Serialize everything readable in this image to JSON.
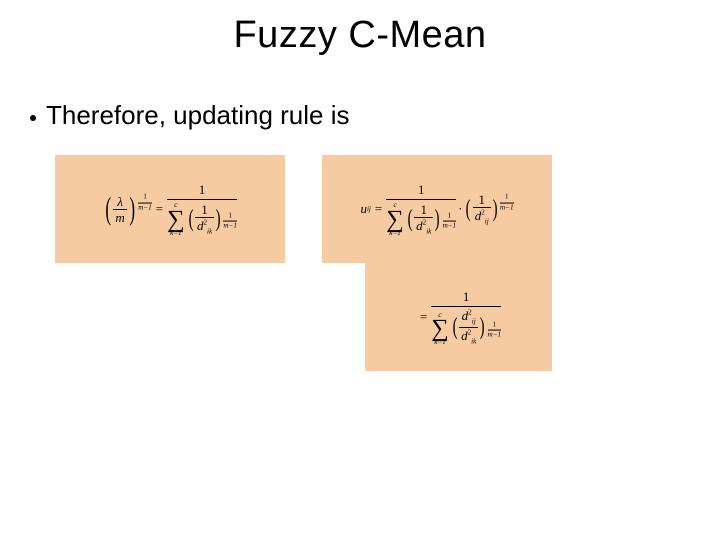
{
  "title": "Fuzzy C-Mean",
  "bullet_text": "Therefore, updating rule is",
  "formulas": {
    "lhs1_lambda": "λ",
    "lhs1_m": "m",
    "exp_num": "1",
    "exp_den_m_minus_1": "m−1",
    "one": "1",
    "sum_upper_c": "c",
    "sum_lower_k": "k=1",
    "d2_ik": "d",
    "ik": "ik",
    "uij": "u",
    "ij": "ij",
    "d2_ij": "d",
    "eq": "="
  }
}
